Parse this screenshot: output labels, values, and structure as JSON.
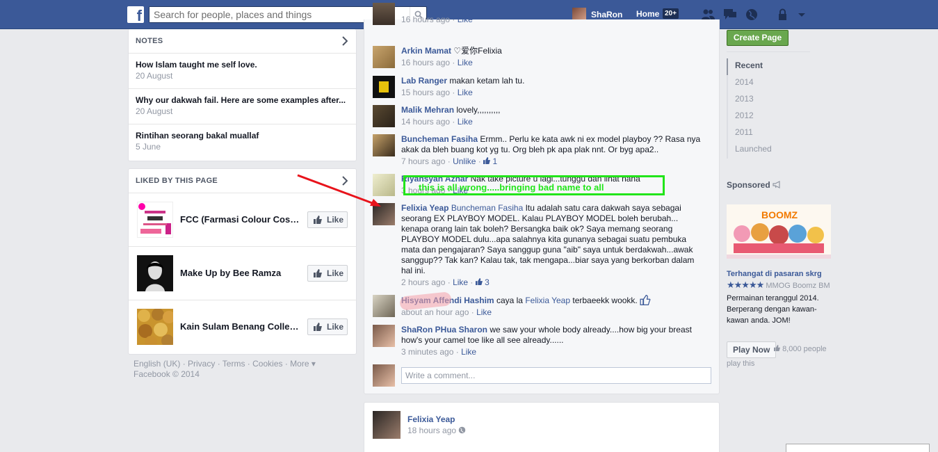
{
  "topbar": {
    "logo": "f",
    "search_placeholder": "Search for people, places and things",
    "user_name": "ShaRon",
    "home_label": "Home",
    "home_badge": "20+",
    "icons": [
      "friend-requests-icon",
      "messages-icon",
      "notifications-globe-icon",
      "privacy-lock-icon",
      "settings-arrow-icon"
    ],
    "colors": {
      "bar": "#3b5998"
    }
  },
  "notes": {
    "heading": "NOTES",
    "items": [
      {
        "title": "How Islam taught me self love.",
        "date": "20 August"
      },
      {
        "title": "Why our dakwah fail. Here are some examples after...",
        "date": "20 August"
      },
      {
        "title": "Rintihan seorang bakal muallaf",
        "date": "5 June"
      }
    ]
  },
  "liked": {
    "heading": "LIKED BY THIS PAGE",
    "like_label": "Like",
    "items": [
      {
        "name": "FCC (Farmasi Colour Cosmetics)"
      },
      {
        "name": "Make Up by Bee Ramza"
      },
      {
        "name": "Kain Sulam Benang Collection"
      }
    ]
  },
  "footer": {
    "links": [
      "English (UK)",
      "Privacy",
      "Cookies",
      "Terms",
      "More"
    ],
    "line1": "English (UK) · Privacy · Terms · Cookies · More ▾",
    "copyright": "Facebook © 2014"
  },
  "comments": [
    {
      "name": "",
      "text": "",
      "time": "16 hours ago",
      "like": "Like",
      "likes": ""
    },
    {
      "name": "Arkin Mamat",
      "text": "♡爱你Felixia",
      "time": "16 hours ago",
      "like": "Like",
      "likes": ""
    },
    {
      "name": "Lab Ranger",
      "text": "makan ketam lah tu.",
      "time": "15 hours ago",
      "like": "Like",
      "likes": ""
    },
    {
      "name": "Malik Mehran",
      "text": "lovely,,,,,,,,,,",
      "time": "14 hours ago",
      "like": "Like",
      "likes": ""
    },
    {
      "name": "Buncheman Fasiha",
      "text": "Ermm.. Perlu ke kata awk ni ex model playboy ?? Rasa nya akak da bleh buang kot yg tu. Org bleh pk apa plak nnt. Or byg apa2..",
      "time": "7 hours ago",
      "like": "Unlike",
      "likes": "1"
    },
    {
      "name": "Riyansyah Azhar",
      "text": "Nak take picture u lagi...tunggu dan lihat nana",
      "time": "3 hours ago",
      "like": "Like",
      "likes": ""
    },
    {
      "name": "Felixia Yeap",
      "tag": "Buncheman Fasiha",
      "text": "Itu adalah satu cara dakwah saya sebagai seorang EX PLAYBOY MODEL. Kalau PLAYBOY MODEL boleh berubah... kenapa orang lain tak boleh? Bersangka baik ok? Saya memang seorang PLAYBOY MODEL dulu...apa salahnya kita gunanya sebagai suatu pembuka mata dan pengajaran? Saya sanggup guna \"aib\" saya untuk berdakwah...awak sanggup?? Tak kan? Kalau tak, tak mengapa...biar saya yang berkorban dalam hal ini.",
      "time": "2 hours ago",
      "like": "Like",
      "likes": "3"
    },
    {
      "name": "Hisyam Affendi Hashim",
      "pre": "caya la",
      "tag": "Felixia Yeap",
      "text": "terbaeekk wookk.",
      "time": "about an hour ago",
      "like": "Like",
      "likes": ""
    },
    {
      "name": "ShaRon PHua Sharon",
      "text": "we saw your whole body already....how big your breast how's your camel toe like all see already......",
      "time": "3 minutes ago",
      "like": "Like",
      "likes": ""
    }
  ],
  "write_placeholder": "Write a comment...",
  "post": {
    "author": "Felixia Yeap",
    "time": "18 hours ago"
  },
  "right": {
    "create_page": "Create Page",
    "years": [
      "Recent",
      "2014",
      "2013",
      "2012",
      "2011",
      "Launched"
    ],
    "sponsored": "Sponsored",
    "ad": {
      "title": "Terhangat di pasaran skrg",
      "stars": "★★★★★",
      "rating_text": "MMOG Boomz BM",
      "desc": "Permainan teranggul 2014. Berperang dengan kawan-kawan anda. JOM!",
      "play_label": "Play Now",
      "count": "8,000 people",
      "count_suffix": "play this",
      "banner": "BOOMZ"
    }
  },
  "annotation": {
    "text": "this is all wrong.....bringing bad name to all",
    "colors": {
      "box": "#22e51a",
      "arrow": "#e8131b"
    }
  }
}
